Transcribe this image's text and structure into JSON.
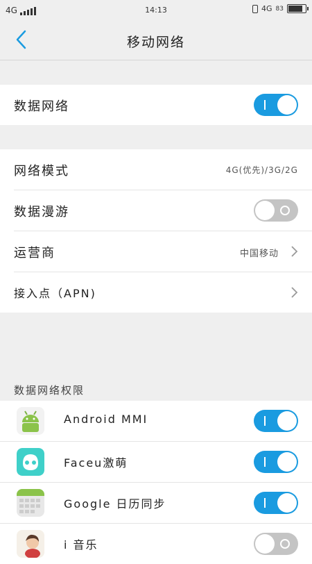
{
  "status_bar": {
    "network": "4G",
    "time": "14:13",
    "network_right": "4G",
    "battery": "83"
  },
  "header": {
    "title": "移动网络"
  },
  "group1": {
    "data_network": {
      "label": "数据网络",
      "toggle": "on"
    }
  },
  "group2": {
    "network_mode": {
      "label": "网络模式",
      "value": "4G(优先)/3G/2G"
    },
    "data_roaming": {
      "label": "数据漫游",
      "toggle": "off"
    },
    "carrier": {
      "label": "运营商",
      "value": "中国移动"
    },
    "apn": {
      "label": "接入点（APN)"
    }
  },
  "permissions": {
    "header": "数据网络权限",
    "apps": [
      {
        "name": "Android MMI",
        "icon": "android-icon",
        "toggle": "on"
      },
      {
        "name": "Faceu激萌",
        "icon": "faceu-icon",
        "toggle": "on"
      },
      {
        "name": "Google 日历同步",
        "icon": "calendar-icon",
        "toggle": "on"
      },
      {
        "name": "i 音乐",
        "icon": "imusic-icon",
        "toggle": "off"
      }
    ]
  },
  "colors": {
    "accent": "#1a9be0",
    "toggle_off": "#c4c4c4",
    "background": "#efefef"
  }
}
